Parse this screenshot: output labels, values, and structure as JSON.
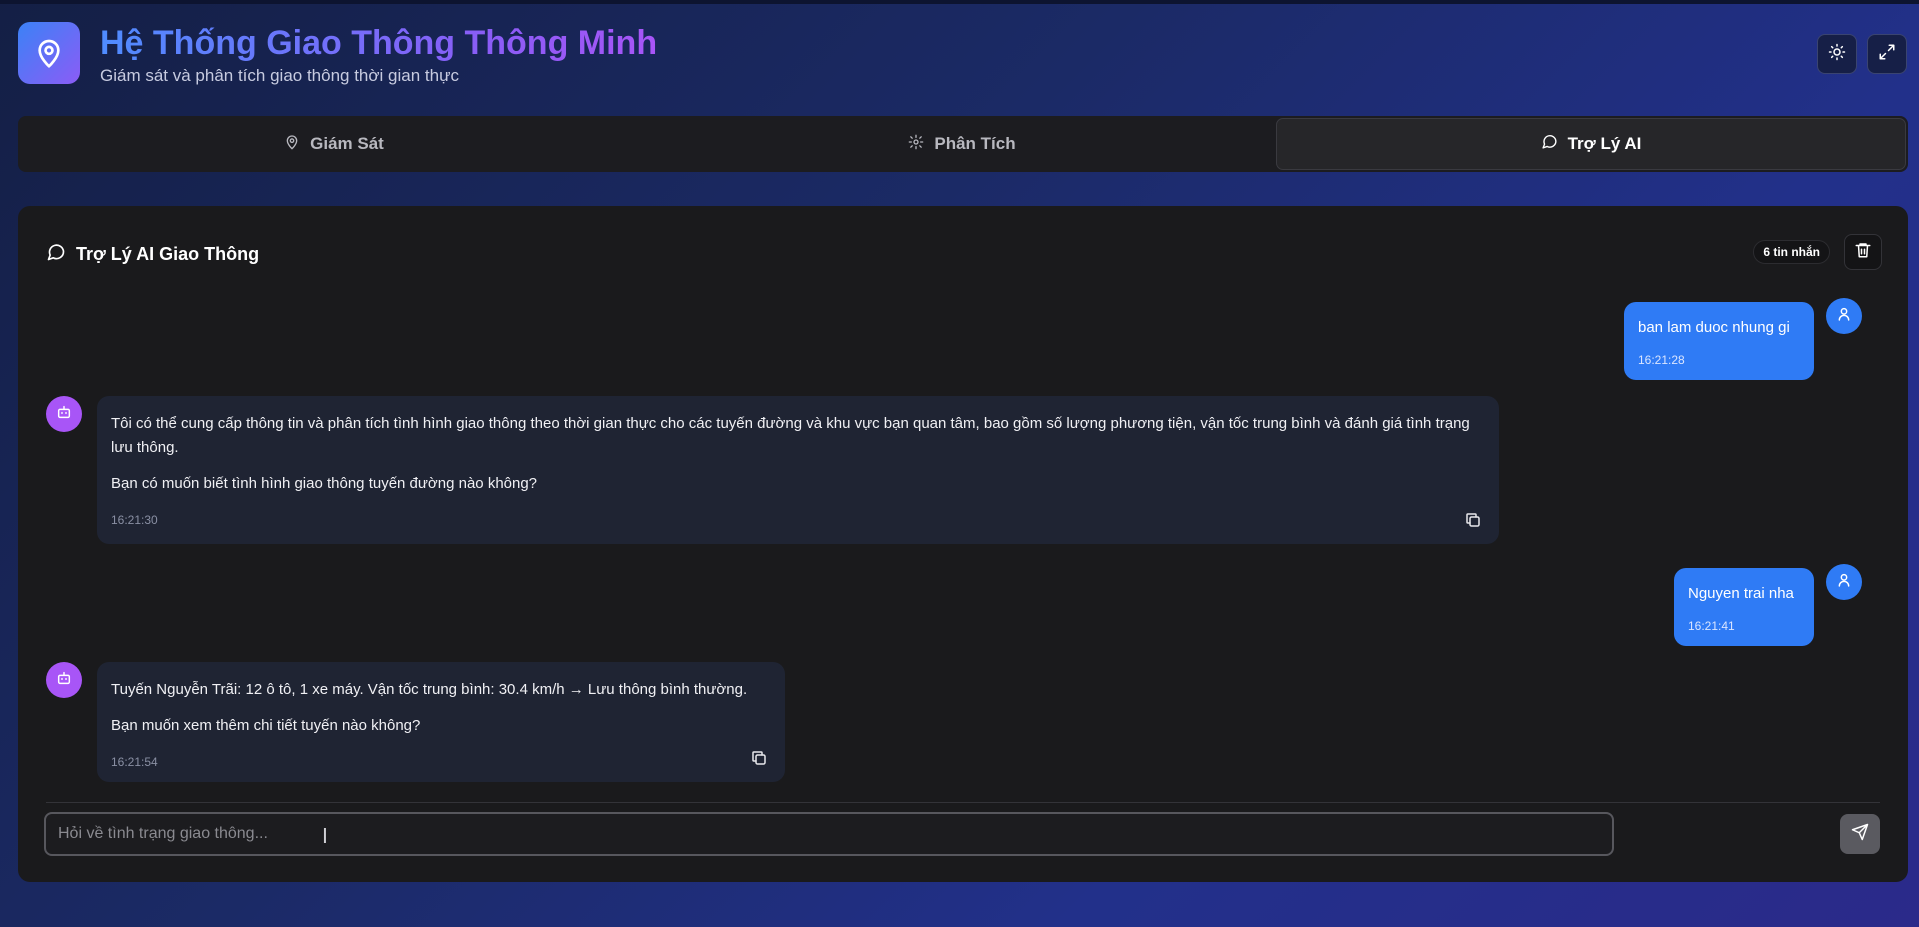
{
  "header": {
    "title": "Hệ Thống Giao Thông Thông Minh",
    "subtitle": "Giám sát và phân tích giao thông thời gian thực",
    "logo_icon": "map-pin-icon",
    "theme_icon": "sun-icon",
    "fullscreen_icon": "expand-icon"
  },
  "tabs": [
    {
      "label": "Giám Sát",
      "icon": "map-pin-icon",
      "active": false
    },
    {
      "label": "Phân Tích",
      "icon": "gear-icon",
      "active": false
    },
    {
      "label": "Trợ Lý AI",
      "icon": "chat-bubble-icon",
      "active": true
    }
  ],
  "chat": {
    "title": "Trợ Lý AI Giao Thông",
    "message_count": "6 tin nhắn",
    "messages": [
      {
        "role": "user",
        "paragraphs": [
          "ban lam duoc nhung gi"
        ],
        "time": "16:21:28"
      },
      {
        "role": "bot",
        "paragraphs": [
          "Tôi có thể cung cấp thông tin và phân tích tình hình giao thông theo thời gian thực cho các tuyến đường và khu vực bạn quan tâm, bao gồm số lượng phương tiện, vận tốc trung bình và đánh giá tình trạng lưu thông.",
          "Bạn có muốn biết tình hình giao thông tuyến đường nào không?"
        ],
        "time": "16:21:30"
      },
      {
        "role": "user",
        "paragraphs": [
          "Nguyen trai nha"
        ],
        "time": "16:21:41"
      },
      {
        "role": "bot",
        "paragraphs": [
          "Tuyến Nguyễn Trãi: 12 ô tô, 1 xe máy. Vận tốc trung bình: 30.4 km/h → Lưu thông bình thường.",
          "Bạn muốn xem thêm chi tiết tuyến nào không?"
        ],
        "time": "16:21:54"
      }
    ],
    "input": {
      "placeholder": "Hỏi về tình trạng giao thông...",
      "value": ""
    }
  },
  "colors": {
    "accent_blue": "#2f7bf5",
    "bot_purple": "#a855f7",
    "panel_bg": "#1a1a1c"
  }
}
